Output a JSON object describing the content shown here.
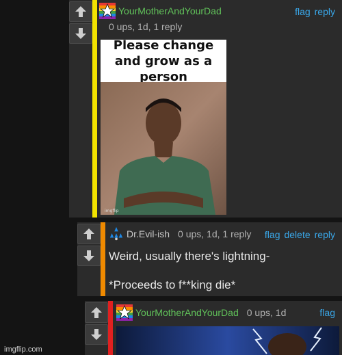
{
  "comments": [
    {
      "username": "YourMotherAndYourDad",
      "meta": "0 ups, 1d, 1 reply",
      "actions": [
        "flag",
        "reply"
      ],
      "bar_color": "#f2e300",
      "meme_caption": "Please change and grow as a person"
    },
    {
      "username": "Dr.Evil-ish",
      "meta": "0 ups, 1d, 1 reply",
      "actions": [
        "flag",
        "delete",
        "reply"
      ],
      "bar_color": "#f08a00",
      "line1": "Weird, usually there's lightning-",
      "line2": "*Proceeds to f**king die*"
    },
    {
      "username": "YourMotherAndYourDad",
      "meta": "0 ups, 1d",
      "actions": [
        "flag"
      ],
      "bar_color": "#e02020"
    }
  ],
  "watermark": "imgflip.com",
  "colors": {
    "link": "#3aa8ea",
    "username": "#61c25a",
    "panel": "#2b2b2b"
  }
}
